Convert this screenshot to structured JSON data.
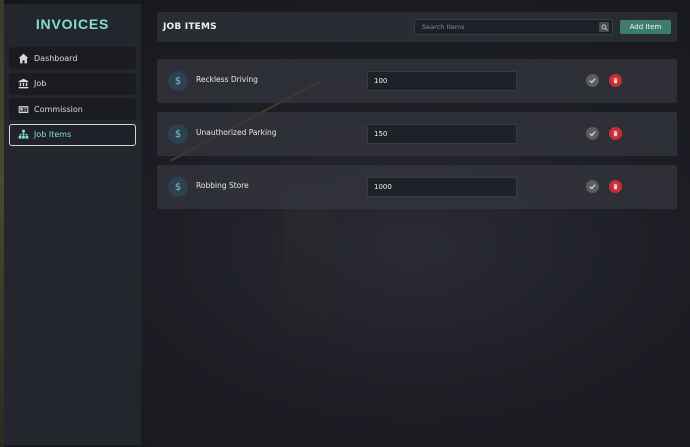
{
  "app": {
    "brand": "INVOICES"
  },
  "sidebar": {
    "items": [
      {
        "label": "Dashboard",
        "icon": "home-icon",
        "active": false
      },
      {
        "label": "Job",
        "icon": "bank-icon",
        "active": false
      },
      {
        "label": "Commission",
        "icon": "id-card-icon",
        "active": false
      },
      {
        "label": "Job Items",
        "icon": "sitemap-icon",
        "active": true
      }
    ]
  },
  "header": {
    "title": "JOB ITEMS",
    "search_placeholder": "Search Items",
    "add_label": "Add Item"
  },
  "items": [
    {
      "name": "Reckless Driving",
      "value": "100",
      "icon": "dollar-icon"
    },
    {
      "name": "Unauthorized Parking",
      "value": "150",
      "icon": "dollar-icon"
    },
    {
      "name": "Robbing Store",
      "value": "1000",
      "icon": "dollar-icon"
    }
  ],
  "colors": {
    "accent": "#7fe3cc",
    "add_button": "#3f7c6d",
    "delete": "#c62f35",
    "confirm": "#5b5d63"
  }
}
